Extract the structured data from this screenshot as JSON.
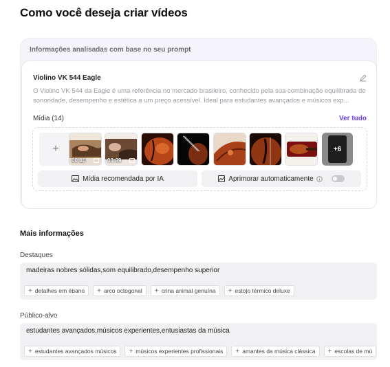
{
  "page": {
    "title": "Como você deseja criar vídeos"
  },
  "analysis": {
    "header": "Informações analisadas com base no seu prompt",
    "product": {
      "name": "Violino VK 544 Eagle",
      "description": "O Violino VK 544 da Eagle é uma referência no mercado brasileiro, conhecido pela sua combinação equilibrada de sonoridade, desempenho e estética a um preço acessível. Ideal para estudantes avançados e músicos exp..."
    },
    "media": {
      "label": "Mídia (14)",
      "see_all": "Ver tudo",
      "add_icon": "plus-icon",
      "thumbnails": [
        {
          "kind": "video",
          "duration": "00:10",
          "subject": "hands-tuning-violin"
        },
        {
          "kind": "video",
          "duration": "00:09",
          "subject": "hands-on-violin"
        },
        {
          "kind": "image",
          "subject": "violin-body-closeup"
        },
        {
          "kind": "image",
          "subject": "violin-on-black"
        },
        {
          "kind": "image",
          "subject": "violin-scroll-closeup"
        },
        {
          "kind": "image",
          "subject": "violin-f-hole-closeup"
        },
        {
          "kind": "image",
          "subject": "violin-case-red"
        }
      ],
      "more_count": "+6"
    },
    "ai_media_button": "Mídia recomendada por IA",
    "auto_enhance": {
      "label": "Aprimorar automaticamente",
      "enabled": false
    }
  },
  "more_info": {
    "title": "Mais informações",
    "highlights": {
      "label": "Destaques",
      "value": "madeiras nobres sólidas,som equilibrado,desempenho superior",
      "suggestions": [
        "detalhes em ébano",
        "arco octogonal",
        "crina animal genuína",
        "estojo térmico deluxe"
      ]
    },
    "audience": {
      "label": "Público-alvo",
      "value": "estudantes avançados,músicos experientes,entusiastas da música",
      "suggestions": [
        "estudantes avançados músicos",
        "músicos experientes profissionais",
        "amantes da música clássica",
        "escolas de mú"
      ]
    }
  },
  "colors": {
    "accent": "#6a3df0",
    "panel_bg": "#f5f4fb",
    "field_bg": "#f1f1f3"
  }
}
